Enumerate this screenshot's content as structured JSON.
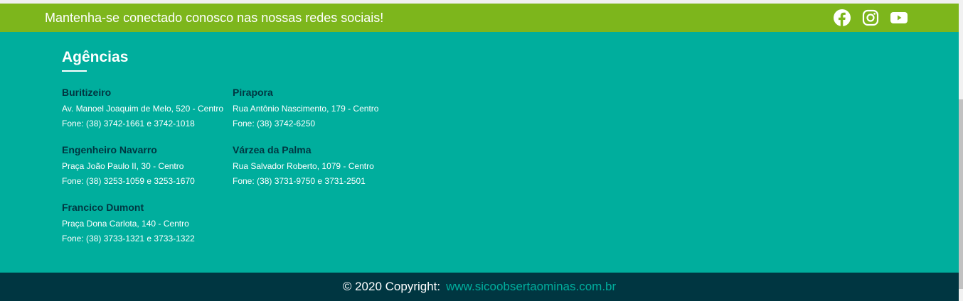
{
  "social": {
    "text": "Mantenha-se conectado conosco nas nossas redes sociais!",
    "icons": [
      "facebook-icon",
      "instagram-icon",
      "youtube-icon"
    ]
  },
  "agencies": {
    "title": "Agências",
    "items": [
      {
        "name": "Buritizeiro",
        "address": "Av. Manoel Joaquim de Melo, 520 - Centro",
        "phone": "Fone: (38) 3742-1661 e 3742-1018"
      },
      {
        "name": "Pirapora",
        "address": "Rua Antônio Nascimento, 179 - Centro",
        "phone": "Fone: (38) 3742-6250"
      },
      {
        "name": "Engenheiro Navarro",
        "address": "Praça João Paulo II, 30 - Centro",
        "phone": "Fone: (38) 3253-1059 e 3253-1670"
      },
      {
        "name": "Várzea da Palma",
        "address": "Rua Salvador Roberto, 1079 - Centro",
        "phone": "Fone: (38) 3731-9750 e 3731-2501"
      },
      {
        "name": "Francico Dumont",
        "address": "Praça Dona Carlota, 140 - Centro",
        "phone": "Fone: (38) 3733-1321 e 3733-1322"
      }
    ]
  },
  "footer": {
    "copyright": "© 2020 Copyright:",
    "link": "www.sicoobsertaominas.com.br"
  },
  "colors": {
    "green": "#7db61c",
    "teal": "#00ae9d",
    "dark": "#003641"
  }
}
